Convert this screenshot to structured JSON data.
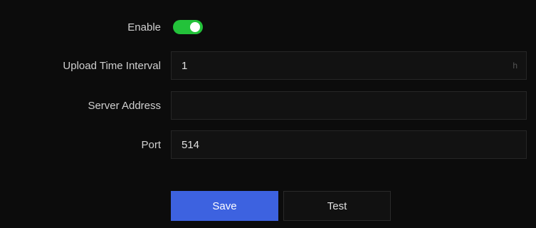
{
  "form": {
    "enable": {
      "label": "Enable",
      "value": true,
      "color": "#23c23a"
    },
    "upload_interval": {
      "label": "Upload Time Interval",
      "value": "1",
      "unit": "h"
    },
    "server_address": {
      "label": "Server Address",
      "value": ""
    },
    "port": {
      "label": "Port",
      "value": "514"
    }
  },
  "actions": {
    "save_label": "Save",
    "test_label": "Test",
    "primary_color": "#3d62e0"
  }
}
